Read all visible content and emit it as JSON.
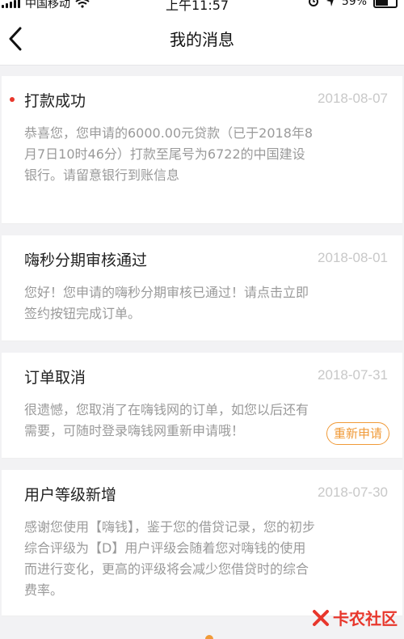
{
  "status_bar": {
    "carrier": "中国移动",
    "time": "上午11:57",
    "battery": "59%",
    "battery_level": 0.59
  },
  "nav": {
    "title": "我的消息"
  },
  "messages": [
    {
      "title": "打款成功",
      "date": "2018-08-07",
      "unread": true,
      "body": "恭喜您，您申请的6000.00元贷款（已于2018年8月7日10时46分）打款至尾号为6722的中国建设银行。请留意银行到账信息"
    },
    {
      "title": "嗨秒分期审核通过",
      "date": "2018-08-01",
      "unread": false,
      "body": "您好！您申请的嗨秒分期审核已通过！请点击立即签约按钮完成订单。"
    },
    {
      "title": "订单取消",
      "date": "2018-07-31",
      "unread": false,
      "body": "很遗憾，您取消了在嗨钱网的订单，如您以后还有需要，可随时登录嗨钱网重新申请哦！",
      "action_label": "重新申请"
    },
    {
      "title": "用户等级新增",
      "date": "2018-07-30",
      "unread": false,
      "body": "感谢您使用【嗨钱】，鉴于您的借贷记录，您的初步综合评级为【D】用户评级会随着您对嗨钱的使用而进行变化，更高的评级将会减少您借贷时的综合费率。"
    }
  ],
  "watermark": {
    "text": "卡农社区"
  },
  "colors": {
    "unread_dot": "#e8372c",
    "accent": "#f09a38",
    "date_text": "#c8c8c8",
    "body_text": "#9a9a9a"
  }
}
